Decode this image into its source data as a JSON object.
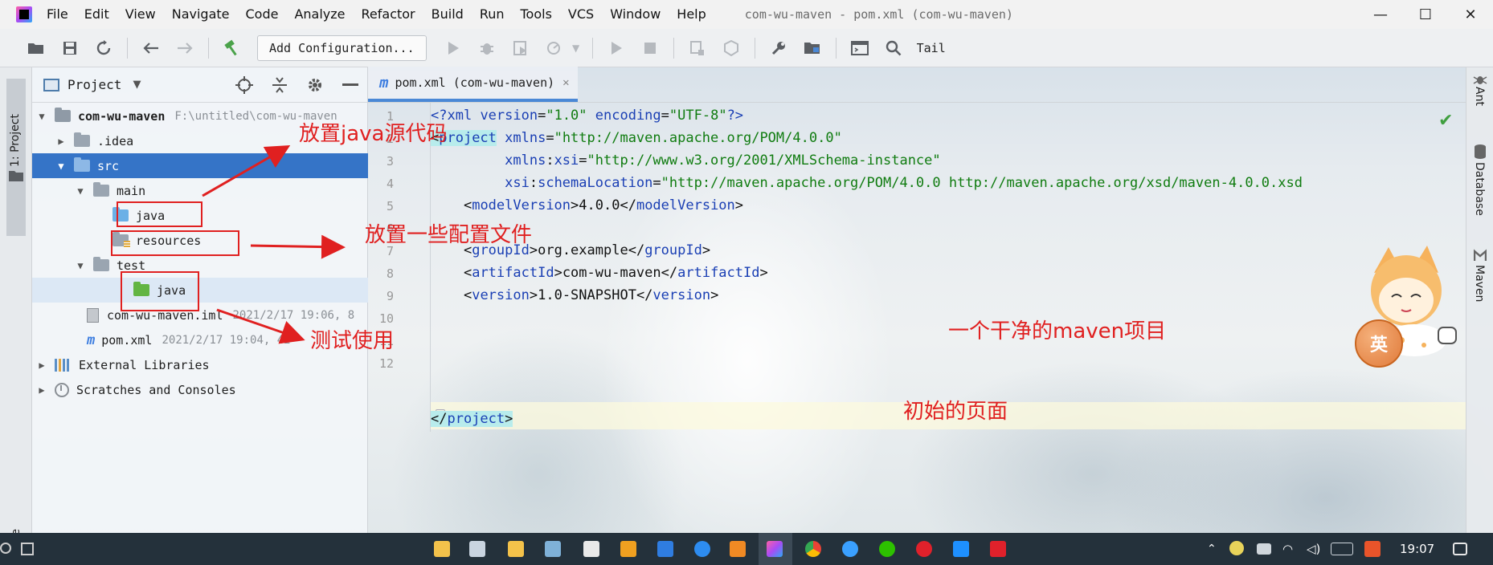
{
  "window": {
    "title": "com-wu-maven - pom.xml (com-wu-maven)",
    "controls": {
      "minimize": "—",
      "maximize": "☐",
      "close": "✕"
    }
  },
  "menu": [
    "File",
    "Edit",
    "View",
    "Navigate",
    "Code",
    "Analyze",
    "Refactor",
    "Build",
    "Run",
    "Tools",
    "VCS",
    "Window",
    "Help"
  ],
  "toolbar": {
    "config_label": "Add Configuration...",
    "tail_label": "Tail"
  },
  "left_strip": {
    "project_tab": "1: Project",
    "structure_tab": "ucture"
  },
  "project_panel": {
    "title": "Project",
    "tree": [
      {
        "label": "com-wu-maven",
        "meta": "F:\\untitled\\com-wu-maven"
      },
      {
        "label": ".idea"
      },
      {
        "label": "src"
      },
      {
        "label": "main"
      },
      {
        "label": "java"
      },
      {
        "label": "resources"
      },
      {
        "label": "test"
      },
      {
        "label": "java"
      },
      {
        "label": "com-wu-maven.iml",
        "meta": "2021/2/17 19:06, 8"
      },
      {
        "label": "pom.xml",
        "meta": "2021/2/17 19:04, 42"
      },
      {
        "label": "External Libraries"
      },
      {
        "label": "Scratches and Consoles"
      }
    ]
  },
  "editor": {
    "tab_label": "pom.xml (com-wu-maven)",
    "line_numbers": [
      "1",
      "2",
      "3",
      "4",
      "5",
      "6",
      "7",
      "8",
      "9",
      "10",
      "11",
      "12"
    ],
    "lines": {
      "l1": {
        "open": "<?",
        "tag": "xml ",
        "a1": "version",
        "eq1": "=",
        "v1": "\"1.0\" ",
        "a2": "encoding",
        "eq2": "=",
        "v2": "\"UTF-8\"",
        "close": "?>"
      },
      "l2": {
        "open": "<",
        "tag": "project",
        "a1": " xmlns",
        "eq1": "=",
        "v1": "\"http://maven.apache.org/POM/4.0.0\""
      },
      "l3": {
        "indent": "         ",
        "a1": "xmlns",
        "colon": ":",
        "a2": "xsi",
        "eq1": "=",
        "v1": "\"http://www.w3.org/2001/XMLSchema-instance\""
      },
      "l4": {
        "indent": "         ",
        "a1": "xsi",
        "colon": ":",
        "a2": "schemaLocation",
        "eq1": "=",
        "v1": "\"http://maven.apache.org/POM/4.0.0 http://maven.apache.org/xsd/maven-4.0.0.xsd"
      },
      "l5": {
        "indent": "    ",
        "open": "<",
        "tag": "modelVersion",
        "gt": ">",
        "text": "4.0.0",
        "end_open": "</",
        "end_tag": "modelVersion",
        "end_gt": ">"
      },
      "l7": {
        "indent": "    ",
        "open": "<",
        "tag": "groupId",
        "gt": ">",
        "text": "org.example",
        "end_open": "</",
        "end_tag": "groupId",
        "end_gt": ">"
      },
      "l8": {
        "indent": "    ",
        "open": "<",
        "tag": "artifactId",
        "gt": ">",
        "text": "com-wu-maven",
        "end_open": "</",
        "end_tag": "artifactId",
        "end_gt": ">"
      },
      "l9": {
        "indent": "    ",
        "open": "<",
        "tag": "version",
        "gt": ">",
        "text": "1.0-SNAPSHOT",
        "end_open": "</",
        "end_tag": "version",
        "end_gt": ">"
      },
      "l12": {
        "end_open": "</",
        "end_tag": "project",
        "end_gt": ">"
      }
    }
  },
  "right_strip": {
    "ant": "Ant",
    "database": "Database",
    "maven": "Maven"
  },
  "annotations": {
    "java_source": "放置java源代码",
    "config_files": "放置一些配置文件",
    "test_use": "测试使用",
    "clean_project": "一个干净的maven项目",
    "initial_page": "初始的页面"
  },
  "ime": {
    "label": "英"
  },
  "taskbar": {
    "time": "19:07"
  },
  "colors": {
    "accent": "#3574c7",
    "annotation": "#e02020",
    "xml_tag": "#1a3fb4",
    "xml_value": "#107c10"
  }
}
